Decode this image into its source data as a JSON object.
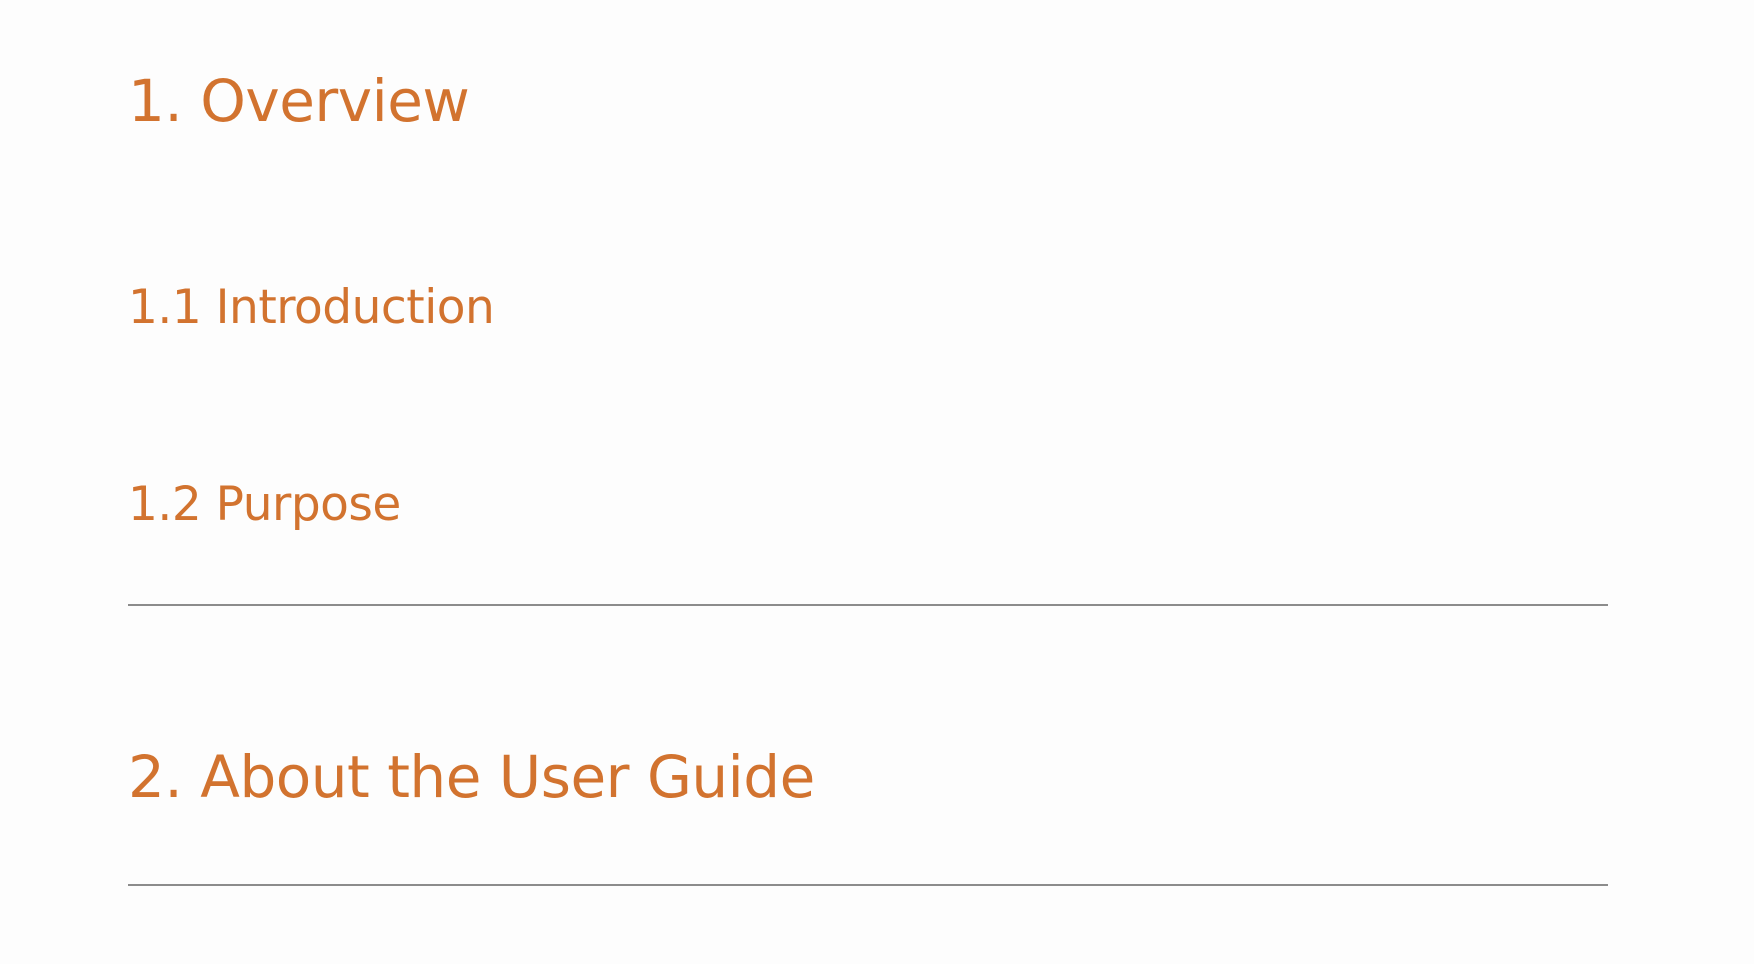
{
  "theme": {
    "heading_color": "#d2732f",
    "rule_color": "#8c8c8c",
    "background": "#fdfdfd"
  },
  "sections": [
    {
      "title": "1. Overview",
      "subsections": [
        {
          "title": "1.1 Introduction"
        },
        {
          "title": "1.2 Purpose"
        }
      ]
    },
    {
      "title": "2. About the User Guide",
      "subsections": []
    }
  ]
}
